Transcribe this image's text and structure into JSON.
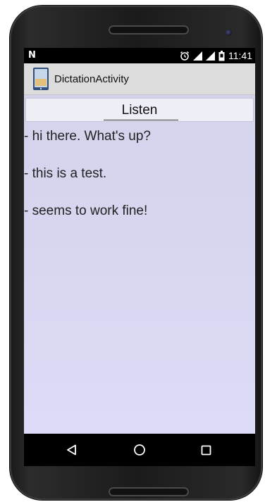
{
  "status_bar": {
    "left_icon": "N",
    "icons": [
      "alarm-icon",
      "signal-icon",
      "signal-icon",
      "battery-icon"
    ],
    "time": "11:41"
  },
  "action_bar": {
    "app_icon": "app-icon",
    "title": "DictationActivity"
  },
  "main": {
    "listen_button": "Listen",
    "transcript": [
      "- hi there. What's up?",
      "- this is a test.",
      "- seems to work fine!"
    ]
  },
  "nav_bar": {
    "buttons": [
      "back-icon",
      "home-icon",
      "recents-icon"
    ]
  },
  "colors": {
    "content_background": "#d8d8f4",
    "action_bar": "#dcdcdc",
    "phone_body": "#1e1e1e"
  }
}
